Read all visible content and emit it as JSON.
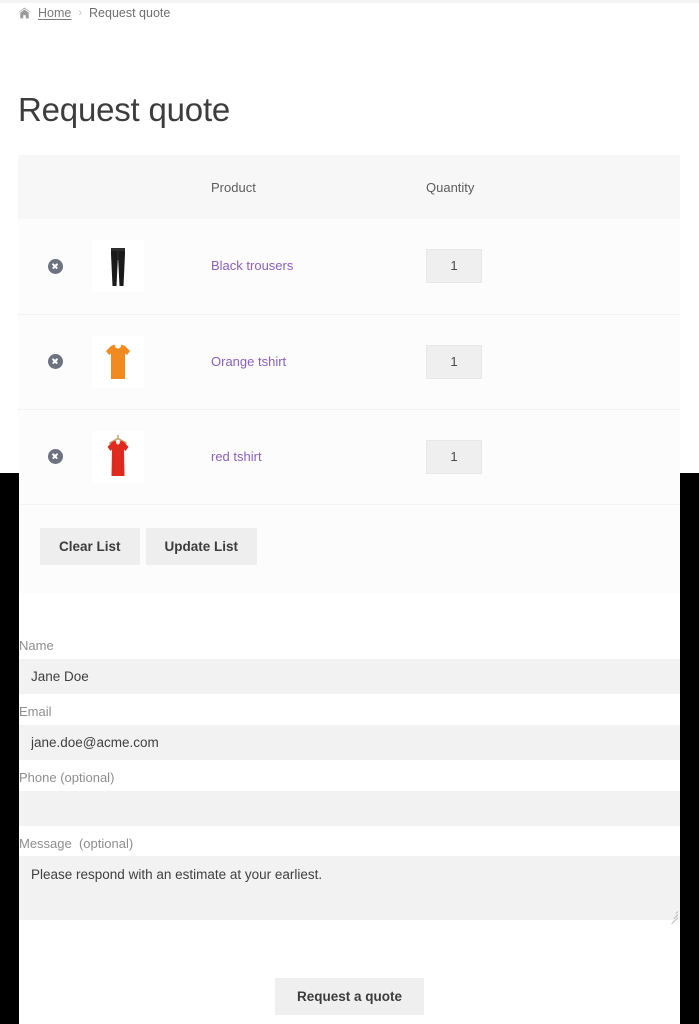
{
  "breadcrumb": {
    "home_icon": "home-icon",
    "home_label": "Home",
    "separator": "›",
    "current": "Request quote"
  },
  "page": {
    "title": "Request quote"
  },
  "table": {
    "headers": {
      "remove": "",
      "thumbnail": "",
      "product": "Product",
      "quantity": "Quantity"
    },
    "rows": [
      {
        "remove_icon": "remove-circle-icon",
        "thumb_name": "black-trousers-thumbnail",
        "product": "Black trousers",
        "quantity": "1"
      },
      {
        "remove_icon": "remove-circle-icon",
        "thumb_name": "orange-tshirt-thumbnail",
        "product": "Orange tshirt",
        "quantity": "1"
      },
      {
        "remove_icon": "remove-circle-icon",
        "thumb_name": "red-tshirt-thumbnail",
        "product": "red tshirt",
        "quantity": "1"
      }
    ]
  },
  "list_actions": {
    "clear": "Clear List",
    "update": "Update List"
  },
  "form": {
    "name": {
      "label": "Name",
      "value": "Jane Doe",
      "placeholder": ""
    },
    "email": {
      "label": "Email",
      "value": "jane.doe@acme.com",
      "placeholder": ""
    },
    "phone": {
      "label": "Phone (optional)",
      "value": "",
      "placeholder": ""
    },
    "message": {
      "label": "Message  (optional)",
      "value": "Please respond with an estimate at your earliest.",
      "placeholder": ""
    },
    "submit": "Request a quote"
  },
  "colors": {
    "link_purple": "#8b5fc4",
    "header_bg": "#f7f7f7",
    "row_bg": "#fcfcfc",
    "input_bg": "#f2f2f2",
    "button_bg": "#eeeeee",
    "remove_icon": "#6d7480",
    "frame_black": "#000000"
  }
}
